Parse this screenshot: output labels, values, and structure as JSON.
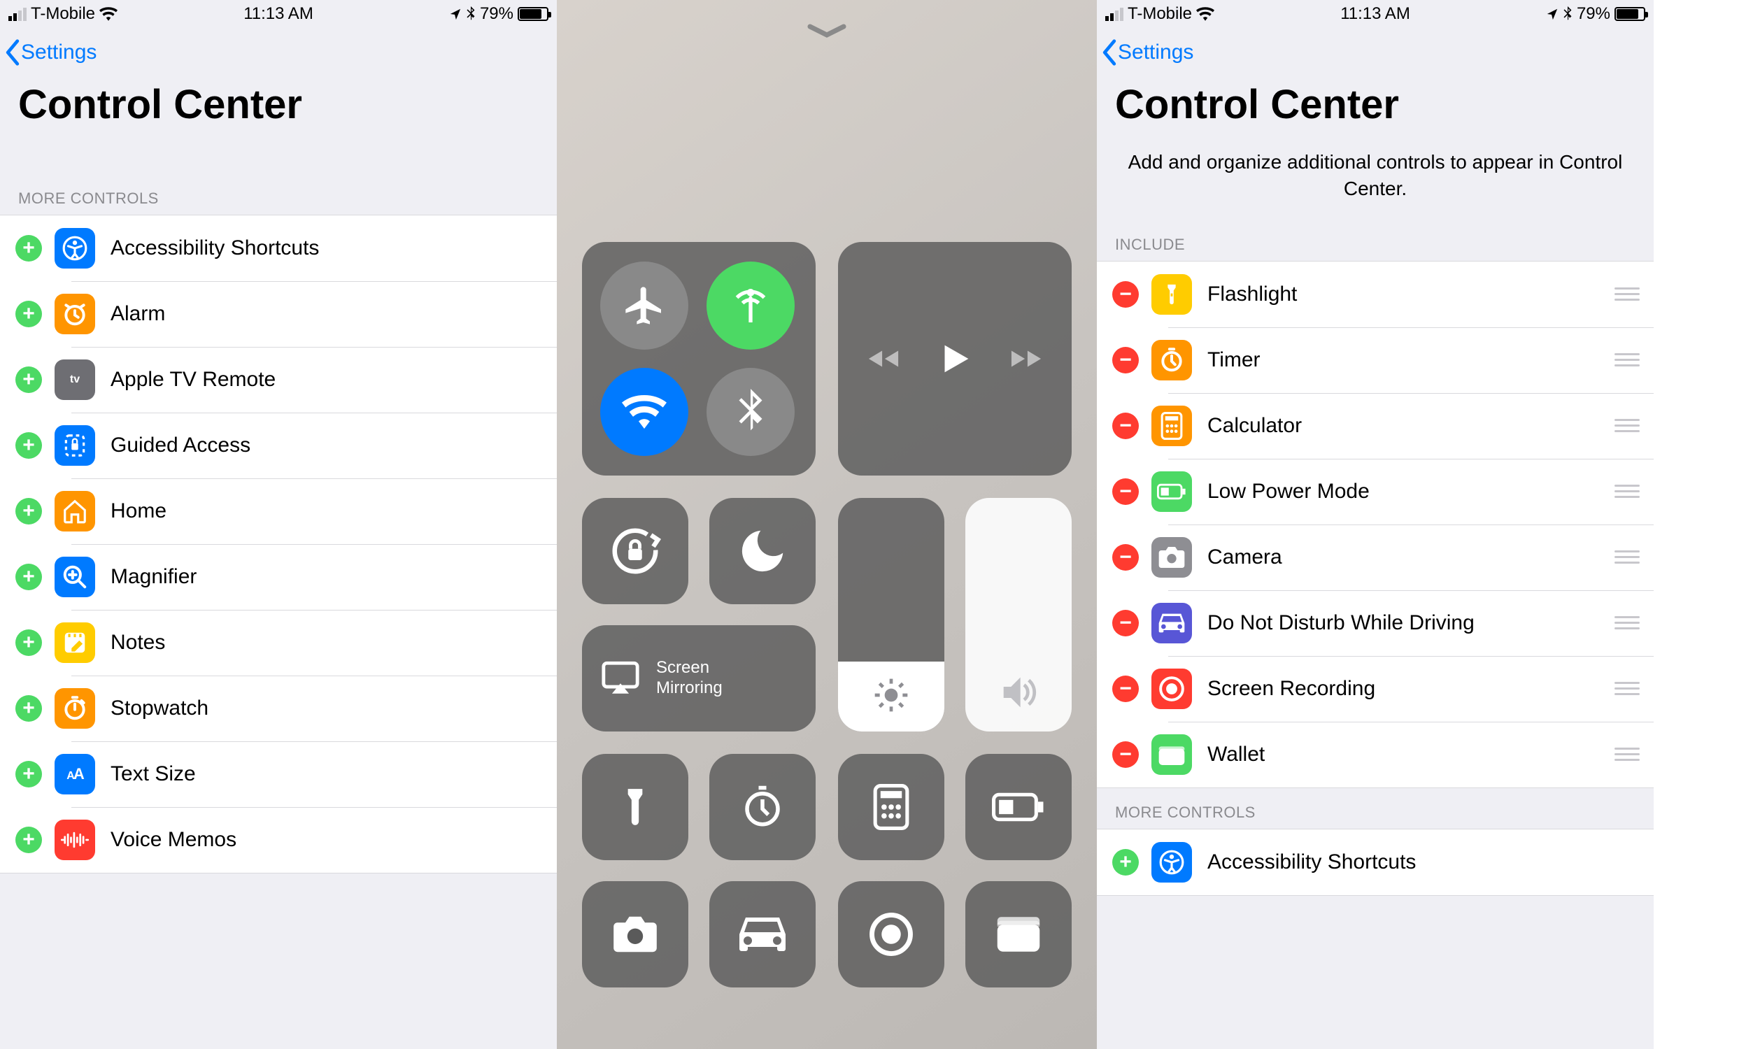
{
  "status": {
    "carrier": "T-Mobile",
    "time": "11:13 AM",
    "battery_pct": "79%"
  },
  "left": {
    "back": "Settings",
    "title": "Control Center",
    "section": "MORE CONTROLS",
    "items": [
      {
        "label": "Accessibility Shortcuts",
        "bg": "#007aff",
        "glyph": "access"
      },
      {
        "label": "Alarm",
        "bg": "#ff9500",
        "glyph": "alarm"
      },
      {
        "label": "Apple TV Remote",
        "bg": "#6e6e73",
        "glyph": "atv"
      },
      {
        "label": "Guided Access",
        "bg": "#007aff",
        "glyph": "guided"
      },
      {
        "label": "Home",
        "bg": "#ff9500",
        "glyph": "home"
      },
      {
        "label": "Magnifier",
        "bg": "#007aff",
        "glyph": "mag"
      },
      {
        "label": "Notes",
        "bg": "#ffcc00",
        "glyph": "notes"
      },
      {
        "label": "Stopwatch",
        "bg": "#ff9500",
        "glyph": "stop"
      },
      {
        "label": "Text Size",
        "bg": "#007aff",
        "glyph": "text"
      },
      {
        "label": "Voice Memos",
        "bg": "#ff3b30",
        "glyph": "voice"
      }
    ]
  },
  "middle": {
    "mirror": "Screen\nMirroring"
  },
  "right": {
    "back": "Settings",
    "title": "Control Center",
    "subtitle": "Add and organize additional controls to appear in Control Center.",
    "include_hdr": "INCLUDE",
    "more_hdr": "MORE CONTROLS",
    "include": [
      {
        "label": "Flashlight",
        "bg": "#ffcc00",
        "glyph": "flash"
      },
      {
        "label": "Timer",
        "bg": "#ff9500",
        "glyph": "timer"
      },
      {
        "label": "Calculator",
        "bg": "#ff9500",
        "glyph": "calc"
      },
      {
        "label": "Low Power Mode",
        "bg": "#4cd964",
        "glyph": "lowp"
      },
      {
        "label": "Camera",
        "bg": "#8e8e93",
        "glyph": "cam"
      },
      {
        "label": "Do Not Disturb While Driving",
        "bg": "#5856d6",
        "glyph": "car"
      },
      {
        "label": "Screen Recording",
        "bg": "#ff3b30",
        "glyph": "rec"
      },
      {
        "label": "Wallet",
        "bg": "#4cd964",
        "glyph": "wallet"
      }
    ],
    "more": [
      {
        "label": "Accessibility Shortcuts",
        "bg": "#007aff",
        "glyph": "access"
      }
    ]
  }
}
